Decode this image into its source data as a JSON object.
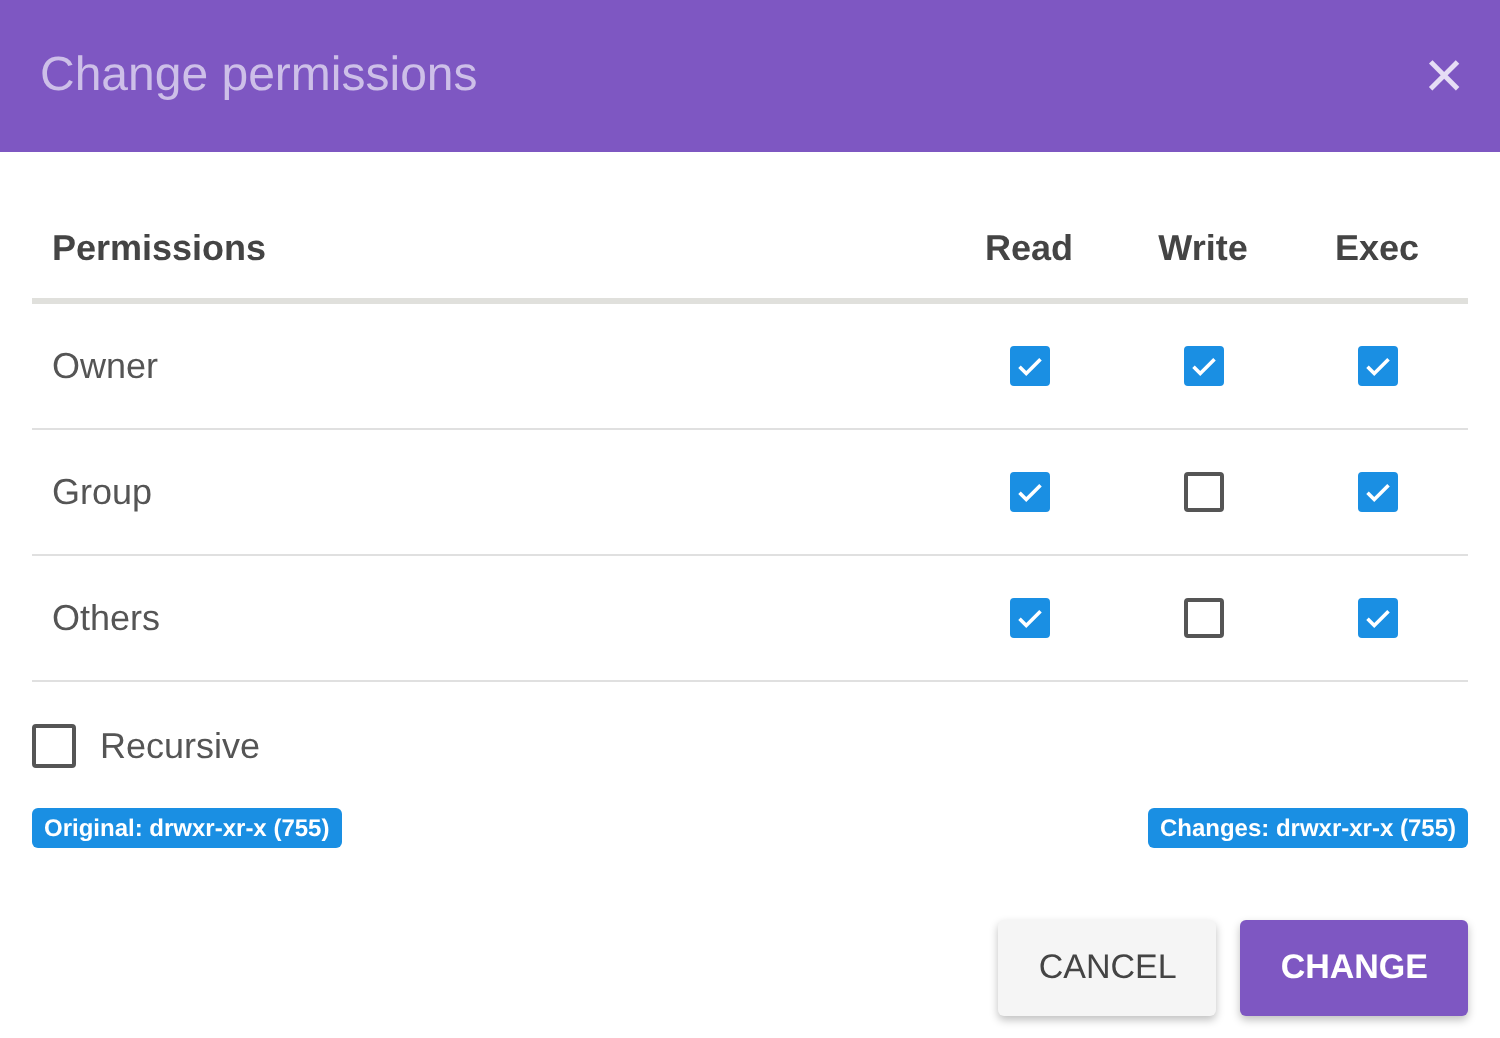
{
  "dialog": {
    "title": "Change permissions",
    "close": "×"
  },
  "table": {
    "columns": [
      "Permissions",
      "Read",
      "Write",
      "Exec"
    ],
    "rows": [
      {
        "name": "Owner",
        "read": true,
        "write": true,
        "exec": true
      },
      {
        "name": "Group",
        "read": true,
        "write": false,
        "exec": true
      },
      {
        "name": "Others",
        "read": true,
        "write": false,
        "exec": true
      }
    ]
  },
  "recursive": {
    "label": "Recursive",
    "checked": false
  },
  "badges": [
    "Original: drwxr-xr-x (755)",
    "Changes: drwxr-xr-x (755)"
  ],
  "buttons": [
    {
      "label": "CANCEL",
      "kind": "secondary"
    },
    {
      "label": "CHANGE",
      "kind": "primary"
    }
  ]
}
